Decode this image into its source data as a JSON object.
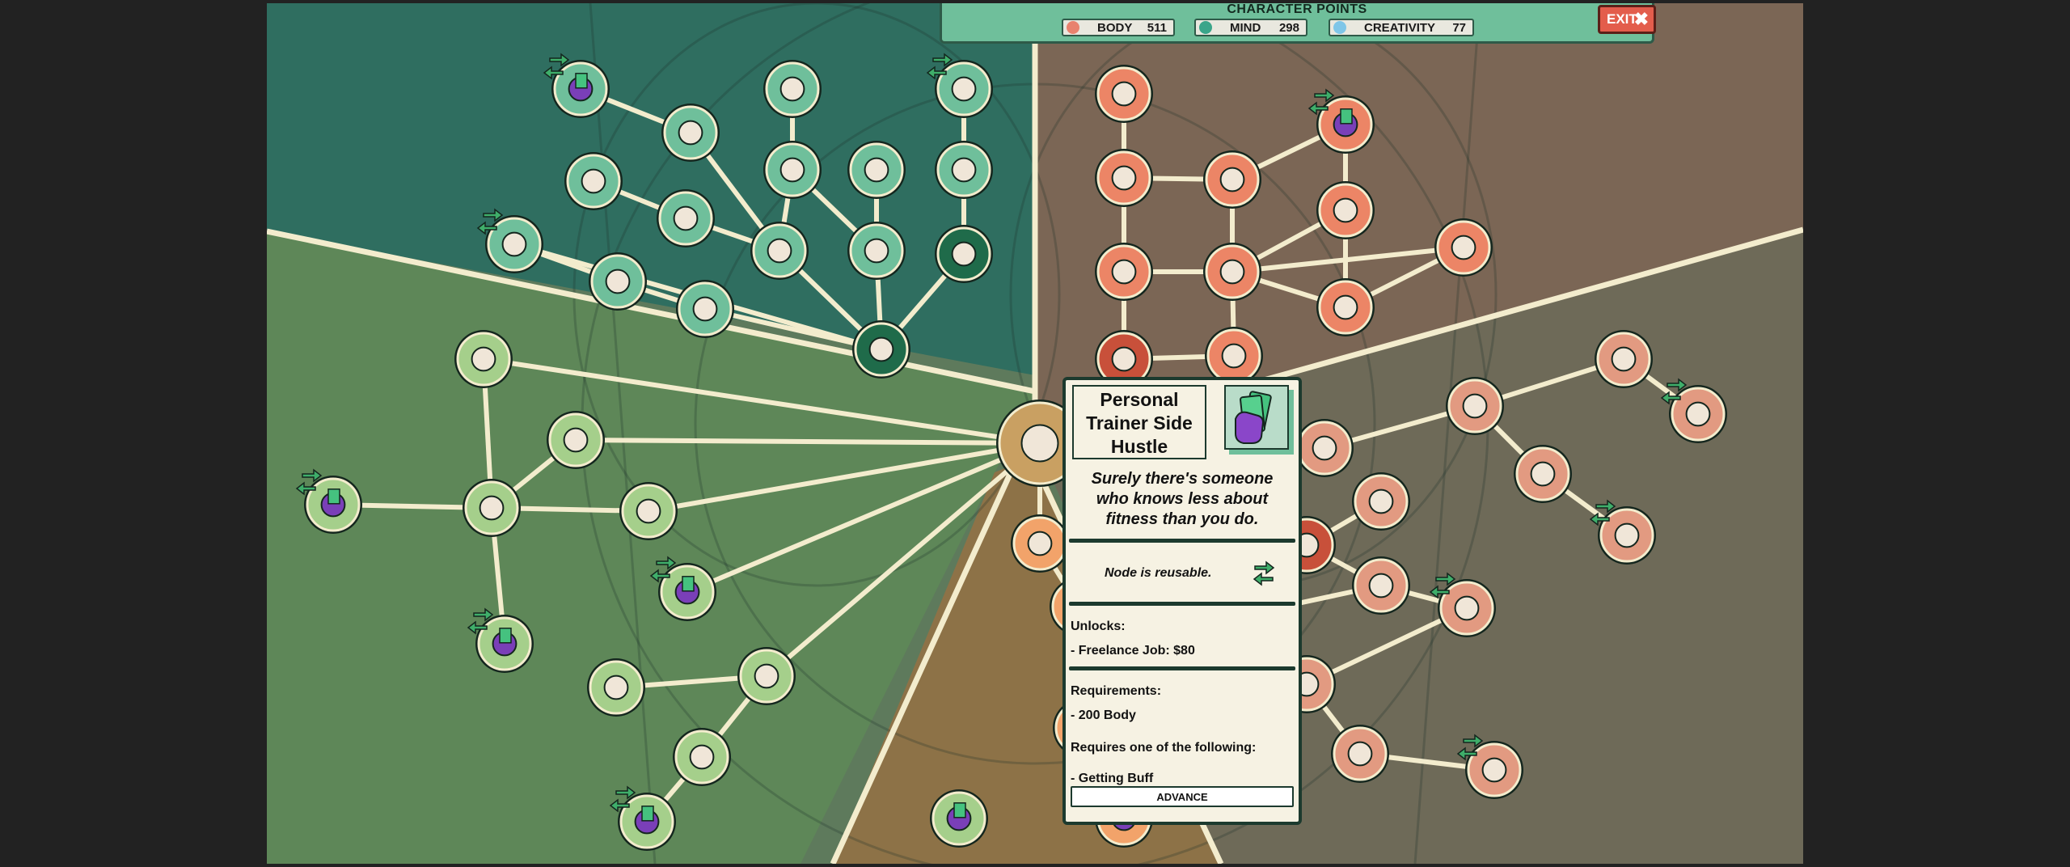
{
  "header": {
    "title": "CHARACTER POINTS",
    "stats": [
      {
        "label": "BODY",
        "value": "511",
        "icon": "flexed-arm-icon",
        "color": "#e8826e"
      },
      {
        "label": "MIND",
        "value": "298",
        "icon": "brain-icon",
        "color": "#3aa58a"
      },
      {
        "label": "CREATIVITY",
        "value": "77",
        "icon": "paint-icon",
        "color": "#7fc6e8"
      }
    ],
    "exit_label": "EXIT"
  },
  "node_detail": {
    "title_lines": [
      "Personal",
      "Trainer Side",
      "Hustle"
    ],
    "icon": "hand-holding-cash-icon",
    "flavor_lines": [
      "Surely there's someone",
      "who knows less about",
      "fitness than you do."
    ],
    "reusable_text": "Node is reusable.",
    "unlocks_header": "Unlocks:",
    "unlocks": [
      "- Freelance Job: $80"
    ],
    "requirements_header": "Requirements:",
    "requirements": [
      "- 200 Body"
    ],
    "requires_one_header": "Requires one of the following:",
    "requires_one": [
      "- Getting Buff"
    ],
    "advance_label": "ADVANCE"
  },
  "skill_tree": {
    "colors": {
      "mind": "#6fbf9b",
      "creativity": "#ec8566",
      "body": "#a5cf8b",
      "social": "#e29a81",
      "tan": "#f2a36a"
    },
    "nodes": [
      {
        "id": "m1",
        "icon": "cash-hand-icon",
        "reusable": true,
        "branch": "mind"
      },
      {
        "id": "m2",
        "icon": "ghost-icon",
        "branch": "mind"
      },
      {
        "id": "m3",
        "icon": "cards-icon",
        "reusable": true,
        "branch": "mind"
      },
      {
        "id": "m4",
        "icon": "glove-icon",
        "branch": "mind"
      },
      {
        "id": "m5",
        "icon": "group-icon",
        "branch": "mind"
      },
      {
        "id": "m6",
        "icon": "octopus-icon",
        "branch": "mind"
      },
      {
        "id": "m7",
        "icon": "wizard-hat-icon",
        "branch": "mind"
      },
      {
        "id": "m8",
        "icon": "curtain-icon",
        "branch": "mind"
      },
      {
        "id": "m9",
        "icon": "flowers-icon",
        "branch": "mind"
      },
      {
        "id": "m10",
        "icon": "bracelet-icon",
        "reusable": true,
        "branch": "mind"
      },
      {
        "id": "m11",
        "icon": "cassette-icon",
        "branch": "mind"
      },
      {
        "id": "m12",
        "icon": "masks-icon",
        "branch": "mind"
      },
      {
        "id": "m13",
        "icon": "quill-icon",
        "branch": "mind",
        "dark": true
      },
      {
        "id": "m14",
        "icon": "pot-icon",
        "branch": "mind"
      },
      {
        "id": "m15",
        "icon": "leaf-icon",
        "branch": "mind"
      },
      {
        "id": "m16",
        "icon": "graffiti-icon",
        "branch": "mind",
        "dark": true
      },
      {
        "id": "c1",
        "icon": "lamp-icon",
        "branch": "creativity"
      },
      {
        "id": "c2",
        "icon": "cash-hand-icon",
        "reusable": true,
        "branch": "creativity"
      },
      {
        "id": "c3",
        "icon": "handshake-icon",
        "branch": "creativity"
      },
      {
        "id": "c4",
        "icon": "dog-icon",
        "branch": "creativity"
      },
      {
        "id": "c5",
        "icon": "heart-icon",
        "branch": "creativity"
      },
      {
        "id": "c6",
        "icon": "badge-icon",
        "branch": "creativity"
      },
      {
        "id": "c7",
        "icon": "couple-icon",
        "branch": "creativity"
      },
      {
        "id": "c8",
        "icon": "glasses-icon",
        "branch": "creativity"
      },
      {
        "id": "c9",
        "icon": "crowd-icon",
        "branch": "creativity"
      },
      {
        "id": "c10",
        "icon": "people-icon",
        "branch": "creativity",
        "dark": true
      },
      {
        "id": "c11",
        "icon": "gamepad-icon",
        "branch": "creativity"
      },
      {
        "id": "b1",
        "icon": "helmet-icon",
        "branch": "body"
      },
      {
        "id": "b2",
        "icon": "jersey-icon",
        "branch": "body"
      },
      {
        "id": "b3",
        "icon": "cash-hand-icon",
        "reusable": true,
        "branch": "body"
      },
      {
        "id": "b4",
        "icon": "trophy-icon",
        "branch": "body"
      },
      {
        "id": "b5",
        "icon": "baseball-glove-icon",
        "branch": "body"
      },
      {
        "id": "b6",
        "icon": "cash-hand-icon",
        "reusable": true,
        "branch": "body"
      },
      {
        "id": "b7",
        "icon": "cash-hand-icon",
        "reusable": true,
        "branch": "body"
      },
      {
        "id": "b8",
        "icon": "whistle-icon",
        "branch": "body"
      },
      {
        "id": "b9",
        "icon": "wave-icon",
        "branch": "body"
      },
      {
        "id": "b10",
        "icon": "tent-icon",
        "branch": "body"
      },
      {
        "id": "b11",
        "icon": "cash-hand-icon",
        "reusable": true,
        "branch": "body"
      },
      {
        "id": "s1",
        "icon": "hat-icon",
        "branch": "social"
      },
      {
        "id": "s2",
        "icon": "book-icon",
        "reusable": true,
        "branch": "social"
      },
      {
        "id": "s3",
        "icon": "figures-icon",
        "branch": "social"
      },
      {
        "id": "s4",
        "icon": "camera-icon",
        "branch": "social"
      },
      {
        "id": "s5",
        "icon": "feather-icon",
        "branch": "social"
      },
      {
        "id": "s6",
        "icon": "microphone-icon",
        "branch": "social",
        "dark": true
      },
      {
        "id": "s7",
        "icon": "tool-icon",
        "branch": "social"
      },
      {
        "id": "s8",
        "icon": "trophy-person-icon",
        "reusable": true,
        "branch": "social"
      },
      {
        "id": "s9",
        "icon": "fist-icon",
        "branch": "social",
        "dark": true
      },
      {
        "id": "s10",
        "icon": "can-icon",
        "branch": "social"
      },
      {
        "id": "s11",
        "icon": "notebook-icon",
        "branch": "social"
      },
      {
        "id": "s12",
        "icon": "outfit-icon",
        "reusable": true,
        "branch": "social"
      },
      {
        "id": "s13",
        "icon": "pair-icon",
        "branch": "social"
      },
      {
        "id": "s14",
        "icon": "fish-icon",
        "branch": "social"
      },
      {
        "id": "s15",
        "icon": "mystery-icon",
        "reusable": true,
        "branch": "social"
      },
      {
        "id": "t1",
        "icon": "figure-icon",
        "branch": "tan"
      },
      {
        "id": "t2",
        "icon": "head-icon",
        "branch": "tan"
      },
      {
        "id": "t3",
        "icon": "hands-icon",
        "branch": "tan"
      },
      {
        "id": "t4",
        "icon": "brain-icon",
        "branch": "tan"
      },
      {
        "id": "t5",
        "icon": "fist-dark-icon",
        "branch": "tan"
      },
      {
        "id": "t6",
        "icon": "cash-hand-icon",
        "reusable": true,
        "branch": "tan"
      },
      {
        "id": "t7",
        "icon": "cash-hand-icon",
        "branch": "body"
      },
      {
        "id": "core",
        "icon": "brain-core-icon",
        "branch": "tan",
        "dark": true
      }
    ]
  }
}
